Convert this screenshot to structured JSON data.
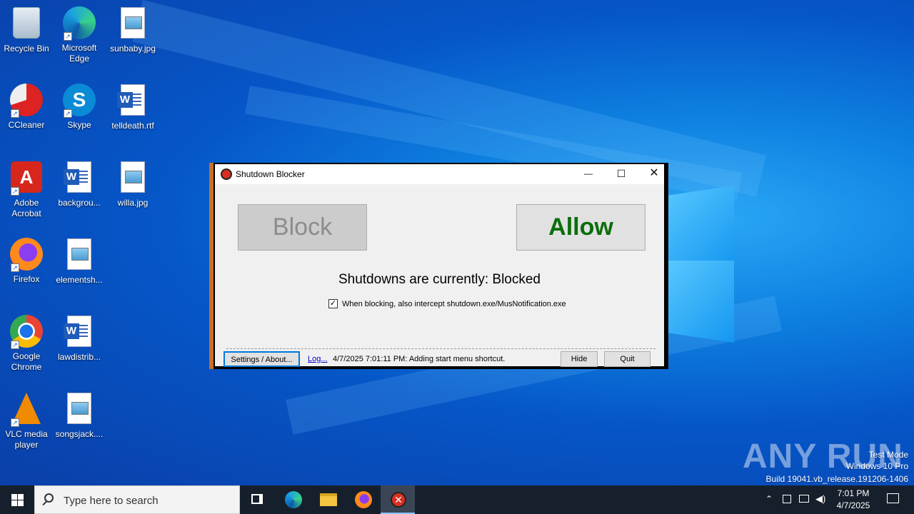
{
  "desktop": {
    "icons": [
      {
        "label": "Recycle Bin"
      },
      {
        "label": "Microsoft Edge"
      },
      {
        "label": "sunbaby.jpg"
      },
      {
        "label": "CCleaner"
      },
      {
        "label": "Skype"
      },
      {
        "label": "telldeath.rtf"
      },
      {
        "label": "Adobe Acrobat"
      },
      {
        "label": "backgrou..."
      },
      {
        "label": "willa.jpg"
      },
      {
        "label": "Firefox"
      },
      {
        "label": "elementsh..."
      },
      {
        "label": "Google Chrome"
      },
      {
        "label": "lawdistrib..."
      },
      {
        "label": "VLC media player"
      },
      {
        "label": "songsjack...."
      }
    ]
  },
  "window": {
    "title": "Shutdown Blocker",
    "controls": {
      "minimize": "—",
      "maximize": "☐",
      "close": "✕"
    },
    "block_label": "Block",
    "allow_label": "Allow",
    "status_text": "Shutdowns are currently: Blocked",
    "checkbox_label": "When blocking, also intercept shutdown.exe/MusNotification.exe",
    "checkbox_checked": true,
    "settings_label": "Settings / About...",
    "log_link": "Log...",
    "log_message": "4/7/2025 7:01:11 PM: Adding start menu shortcut.",
    "hide_label": "Hide",
    "quit_label": "Quit",
    "colors": {
      "allow_text": "#0a6e0a",
      "block_text": "#8c8c8c",
      "frame": "#c8702a"
    }
  },
  "watermark": {
    "brand": "ANY RUN",
    "test_mode": "Test Mode",
    "edition": "Windows 10 Pro",
    "build": "Build 19041.vb_release.191206-1406"
  },
  "taskbar": {
    "search_placeholder": "Type here to search",
    "apps": [
      "task-view",
      "microsoft-edge",
      "file-explorer",
      "firefox",
      "shutdown-blocker"
    ],
    "active_app": "shutdown-blocker",
    "time": "7:01 PM",
    "date": "4/7/2025"
  }
}
